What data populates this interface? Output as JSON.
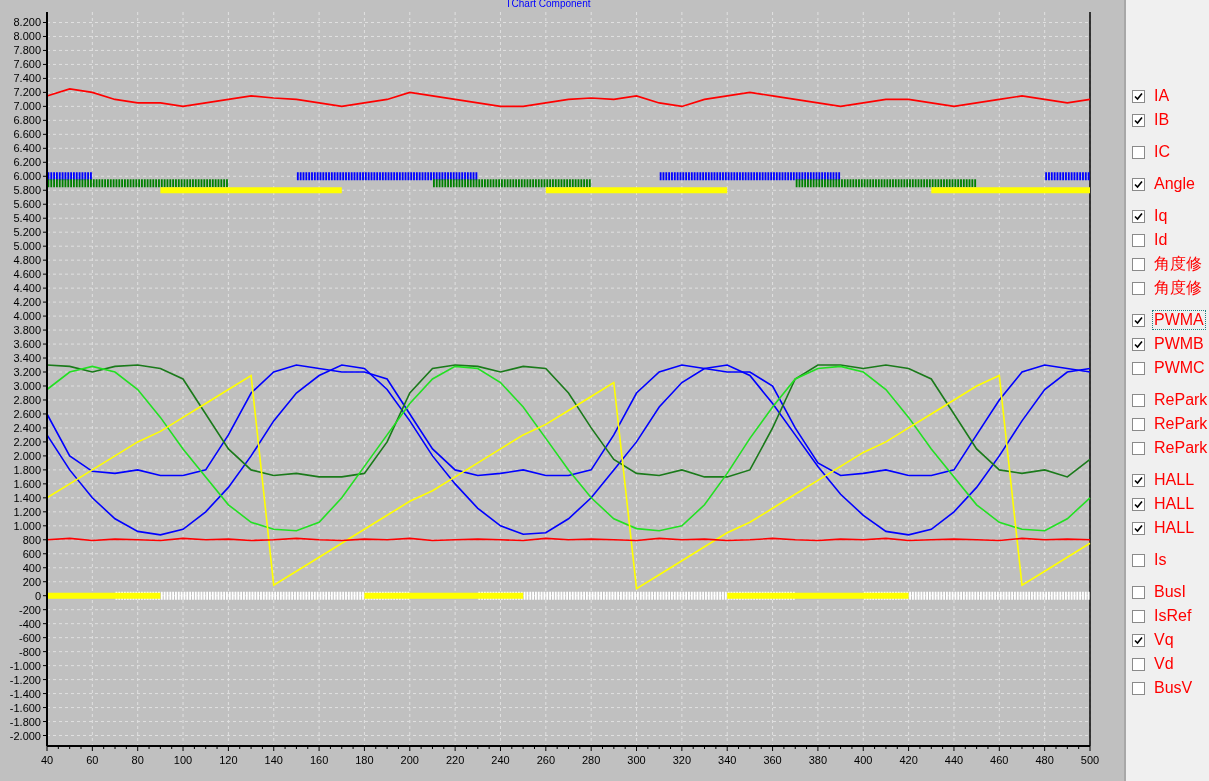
{
  "chart": {
    "chart_data": {
      "type": "line",
      "title": "TChart Component",
      "x": [
        40,
        50,
        60,
        70,
        80,
        90,
        100,
        110,
        120,
        130,
        140,
        150,
        160,
        170,
        180,
        190,
        200,
        210,
        220,
        230,
        240,
        250,
        260,
        270,
        280,
        290,
        300,
        310,
        320,
        330,
        340,
        350,
        360,
        370,
        380,
        390,
        400,
        410,
        420,
        430,
        440,
        450,
        460,
        470,
        480,
        490,
        500
      ],
      "xlim": [
        40,
        500
      ],
      "ylim": [
        -2150,
        8350
      ],
      "grid": true,
      "xticks": [
        40,
        60,
        80,
        100,
        120,
        140,
        160,
        180,
        200,
        220,
        240,
        260,
        280,
        300,
        320,
        340,
        360,
        380,
        400,
        420,
        440,
        460,
        480,
        500
      ],
      "yticks": [
        {
          "value": 8200,
          "label": "8.200"
        },
        {
          "value": 8000,
          "label": "8.000"
        },
        {
          "value": 7800,
          "label": "7.800"
        },
        {
          "value": 7600,
          "label": "7.600"
        },
        {
          "value": 7400,
          "label": "7.400"
        },
        {
          "value": 7200,
          "label": "7.200"
        },
        {
          "value": 7000,
          "label": "7.000"
        },
        {
          "value": 6800,
          "label": "6.800"
        },
        {
          "value": 6600,
          "label": "6.600"
        },
        {
          "value": 6400,
          "label": "6.400"
        },
        {
          "value": 6200,
          "label": "6.200"
        },
        {
          "value": 6000,
          "label": "6.000"
        },
        {
          "value": 5800,
          "label": "5.800"
        },
        {
          "value": 5600,
          "label": "5.600"
        },
        {
          "value": 5400,
          "label": "5.400"
        },
        {
          "value": 5200,
          "label": "5.200"
        },
        {
          "value": 5000,
          "label": "5.000"
        },
        {
          "value": 4800,
          "label": "4.800"
        },
        {
          "value": 4600,
          "label": "4.600"
        },
        {
          "value": 4400,
          "label": "4.400"
        },
        {
          "value": 4200,
          "label": "4.200"
        },
        {
          "value": 4000,
          "label": "4.000"
        },
        {
          "value": 3800,
          "label": "3.800"
        },
        {
          "value": 3600,
          "label": "3.600"
        },
        {
          "value": 3400,
          "label": "3.400"
        },
        {
          "value": 3200,
          "label": "3.200"
        },
        {
          "value": 3000,
          "label": "3.000"
        },
        {
          "value": 2800,
          "label": "2.800"
        },
        {
          "value": 2600,
          "label": "2.600"
        },
        {
          "value": 2400,
          "label": "2.400"
        },
        {
          "value": 2200,
          "label": "2.200"
        },
        {
          "value": 2000,
          "label": "2.000"
        },
        {
          "value": 1800,
          "label": "1.800"
        },
        {
          "value": 1600,
          "label": "1.600"
        },
        {
          "value": 1400,
          "label": "1.400"
        },
        {
          "value": 1200,
          "label": "1.200"
        },
        {
          "value": 1000,
          "label": "1.000"
        },
        800,
        600,
        400,
        200,
        0,
        -200,
        -400,
        -600,
        -800,
        {
          "value": -1000,
          "label": "-1.000"
        },
        {
          "value": -1200,
          "label": "-1.200"
        },
        {
          "value": -1400,
          "label": "-1.400"
        },
        {
          "value": -1600,
          "label": "-1.600"
        },
        {
          "value": -1800,
          "label": "-1.800"
        },
        {
          "value": -2000,
          "label": "-2.000"
        }
      ],
      "series": [
        {
          "line_style": "solid",
          "color": "#ff0000",
          "values": [
            7150,
            7250,
            7200,
            7100,
            7050,
            7050,
            7000,
            7050,
            7100,
            7150,
            7120,
            7100,
            7050,
            7000,
            7050,
            7100,
            7200,
            7150,
            7100,
            7050,
            7000,
            7000,
            7050,
            7100,
            7120,
            7100,
            7150,
            7050,
            7000,
            7100,
            7150,
            7200,
            7150,
            7100,
            7050,
            7000,
            7050,
            7100,
            7100,
            7050,
            7000,
            7050,
            7100,
            7150,
            7100,
            7050,
            7100
          ]
        },
        {
          "line_style": "dashed",
          "color": "#0000ff",
          "values": [
            6000,
            6000,
            6000,
            null,
            null,
            null,
            null,
            null,
            null,
            null,
            null,
            6000,
            6000,
            6000,
            6000,
            6000,
            6000,
            6000,
            6000,
            6000,
            null,
            null,
            null,
            null,
            null,
            null,
            null,
            6000,
            6000,
            6000,
            6000,
            6000,
            6000,
            6000,
            6000,
            6000,
            null,
            null,
            null,
            null,
            null,
            null,
            null,
            null,
            6000,
            6000,
            6000
          ]
        },
        {
          "line_style": "dashed",
          "color": "#008000",
          "values": [
            5900,
            5900,
            5900,
            5900,
            5900,
            5900,
            5900,
            5900,
            5900,
            null,
            null,
            null,
            null,
            null,
            null,
            null,
            null,
            5900,
            5900,
            5900,
            5900,
            5900,
            5900,
            5900,
            5900,
            null,
            null,
            null,
            null,
            null,
            null,
            null,
            null,
            5900,
            5900,
            5900,
            5900,
            5900,
            5900,
            5900,
            5900,
            5900,
            null,
            null,
            null,
            null,
            null
          ]
        },
        {
          "line_style": "solid",
          "color": "#ffff00",
          "values": [
            null,
            null,
            null,
            null,
            null,
            5800,
            5800,
            5800,
            5800,
            5800,
            5800,
            5800,
            5800,
            5800,
            null,
            null,
            null,
            null,
            null,
            null,
            null,
            null,
            5800,
            5800,
            5800,
            5800,
            5800,
            5800,
            5800,
            5800,
            5800,
            null,
            null,
            null,
            null,
            null,
            null,
            null,
            null,
            5800,
            5800,
            5800,
            5800,
            5800,
            5800,
            5800,
            5800
          ]
        },
        {
          "line_style": "solid",
          "color": "#0000ff",
          "values": [
            2600,
            2000,
            1780,
            1750,
            1800,
            1720,
            1720,
            1800,
            2300,
            2900,
            3200,
            3300,
            3250,
            3200,
            3200,
            3100,
            2600,
            2100,
            1800,
            1720,
            1750,
            1800,
            1720,
            1720,
            1800,
            2300,
            2900,
            3200,
            3300,
            3250,
            3200,
            3200,
            3000,
            2400,
            1900,
            1720,
            1750,
            1800,
            1720,
            1720,
            1800,
            2300,
            2800,
            3200,
            3300,
            3250,
            3200
          ]
        },
        {
          "line_style": "solid",
          "color": "#0000ff",
          "values": [
            2300,
            1800,
            1400,
            1100,
            920,
            870,
            950,
            1200,
            1550,
            2000,
            2500,
            2900,
            3150,
            3300,
            3250,
            2950,
            2500,
            2000,
            1600,
            1250,
            1000,
            880,
            900,
            1100,
            1400,
            1800,
            2200,
            2700,
            3050,
            3250,
            3300,
            3150,
            2750,
            2300,
            1850,
            1450,
            1150,
            920,
            870,
            950,
            1200,
            1550,
            2000,
            2500,
            2950,
            3200,
            3250
          ]
        },
        {
          "line_style": "solid",
          "color": "#1a7a1a",
          "values": [
            3300,
            3280,
            3200,
            3280,
            3300,
            3250,
            3100,
            2600,
            2100,
            1800,
            1720,
            1750,
            1700,
            1700,
            1750,
            2200,
            2900,
            3250,
            3300,
            3280,
            3200,
            3280,
            3250,
            2900,
            2400,
            1950,
            1750,
            1720,
            1800,
            1700,
            1700,
            1800,
            2400,
            3100,
            3300,
            3300,
            3250,
            3300,
            3250,
            3100,
            2600,
            2100,
            1800,
            1750,
            1800,
            1700,
            1950
          ]
        },
        {
          "line_style": "solid",
          "color": "#22e022",
          "values": [
            2950,
            3200,
            3280,
            3200,
            2950,
            2550,
            2100,
            1700,
            1300,
            1050,
            950,
            930,
            1050,
            1400,
            1850,
            2300,
            2750,
            3100,
            3280,
            3250,
            3050,
            2700,
            2250,
            1800,
            1400,
            1100,
            960,
            930,
            1000,
            1300,
            1750,
            2250,
            2700,
            3100,
            3250,
            3280,
            3200,
            2950,
            2550,
            2100,
            1700,
            1300,
            1050,
            950,
            930,
            1100,
            1400
          ]
        },
        {
          "line_style": "solid",
          "color": "#ffff00",
          "values": [
            1400,
            1600,
            1800,
            2000,
            2200,
            2350,
            2550,
            2750,
            2950,
            3150,
            150,
            350,
            550,
            750,
            950,
            1150,
            1350,
            1500,
            1700,
            1900,
            2100,
            2300,
            2450,
            2650,
            2850,
            3050,
            100,
            300,
            500,
            700,
            900,
            1050,
            1250,
            1450,
            1650,
            1850,
            2050,
            2200,
            2400,
            2600,
            2800,
            3000,
            3150,
            150,
            350,
            550,
            750
          ]
        },
        {
          "line_style": "solid",
          "color": "#ff0000",
          "values": [
            800,
            820,
            790,
            810,
            800,
            790,
            820,
            800,
            810,
            790,
            800,
            820,
            800,
            790,
            810,
            800,
            820,
            790,
            800,
            810,
            800,
            790,
            820,
            800,
            810,
            800,
            790,
            820,
            800,
            810,
            790,
            800,
            820,
            800,
            790,
            810,
            800,
            820,
            790,
            800,
            810,
            800,
            790,
            820,
            800,
            810,
            800
          ]
        },
        {
          "line_style": "dashed",
          "color": "#ffffff",
          "values": [
            null,
            null,
            null,
            0,
            0,
            0,
            0,
            0,
            0,
            0,
            0,
            0,
            0,
            0,
            0,
            0,
            0,
            null,
            null,
            0,
            0,
            0,
            0,
            0,
            0,
            0,
            0,
            0,
            0,
            0,
            0,
            0,
            0,
            0,
            null,
            null,
            0,
            0,
            0,
            0,
            0,
            0,
            0,
            0,
            0,
            0,
            0
          ]
        },
        {
          "line_style": "solid",
          "color": "#ffff00",
          "values": [
            0,
            0,
            0,
            0,
            0,
            0,
            null,
            null,
            null,
            null,
            null,
            null,
            null,
            null,
            0,
            0,
            0,
            0,
            0,
            0,
            0,
            0,
            null,
            null,
            null,
            null,
            null,
            null,
            null,
            null,
            0,
            0,
            0,
            0,
            0,
            0,
            0,
            0,
            0,
            null,
            null,
            null,
            null,
            null,
            null,
            null,
            null
          ]
        }
      ]
    }
  },
  "legend": {
    "groups": [
      [
        {
          "label": "IA",
          "checked": true,
          "focused": false
        },
        {
          "label": "IB",
          "checked": true,
          "focused": false
        }
      ],
      [
        {
          "label": "IC",
          "checked": false,
          "focused": false
        }
      ],
      [
        {
          "label": "Angle",
          "checked": true,
          "focused": false
        }
      ],
      [
        {
          "label": "Iq",
          "checked": true,
          "focused": false
        },
        {
          "label": "Id",
          "checked": false,
          "focused": false
        },
        {
          "label": "角度修",
          "checked": false,
          "focused": false
        },
        {
          "label": "角度修",
          "checked": false,
          "focused": false
        }
      ],
      [
        {
          "label": "PWMA",
          "checked": true,
          "focused": true
        },
        {
          "label": "PWMB",
          "checked": true,
          "focused": false
        },
        {
          "label": "PWMC",
          "checked": false,
          "focused": false
        }
      ],
      [
        {
          "label": "RePark",
          "checked": false,
          "focused": false
        },
        {
          "label": "RePark",
          "checked": false,
          "focused": false
        },
        {
          "label": "RePark",
          "checked": false,
          "focused": false
        }
      ],
      [
        {
          "label": "HALL",
          "checked": true,
          "focused": false
        },
        {
          "label": "HALL",
          "checked": true,
          "focused": false
        },
        {
          "label": "HALL",
          "checked": true,
          "focused": false
        }
      ],
      [
        {
          "label": "Is",
          "checked": false,
          "focused": false
        }
      ],
      [
        {
          "label": "BusI",
          "checked": false,
          "focused": false
        },
        {
          "label": "IsRef",
          "checked": false,
          "focused": false
        },
        {
          "label": "Vq",
          "checked": true,
          "focused": false
        },
        {
          "label": "Vd",
          "checked": false,
          "focused": false
        },
        {
          "label": "BusV",
          "checked": false,
          "focused": false
        }
      ]
    ]
  }
}
